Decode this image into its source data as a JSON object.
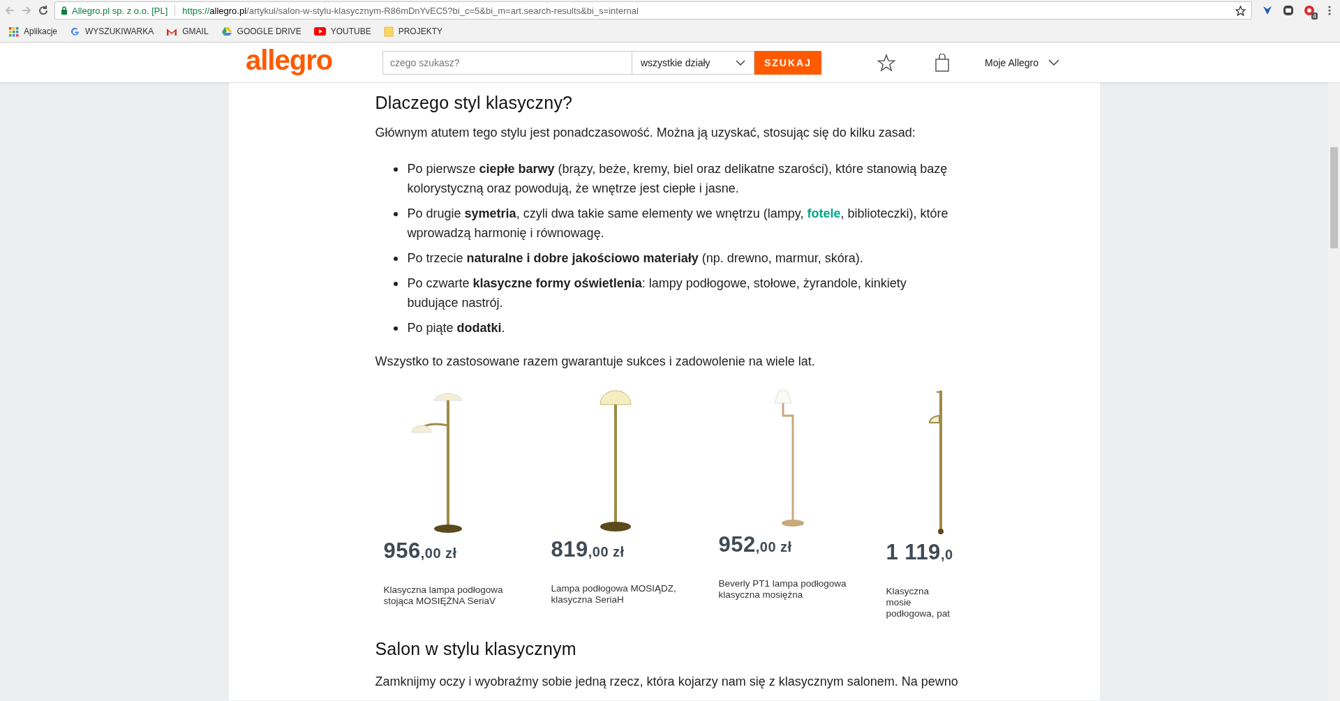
{
  "browser": {
    "site_identity": "Allegro.pl sp. z o.o. [PL]",
    "url": {
      "scheme": "https://",
      "host": "allegro.pl",
      "path": "/artykul/salon-w-stylu-klasycznym-R86mDnYvEC5?bi_c=5&bi_m=art.search-results&bi_s=internal"
    },
    "extension_badge": "4",
    "bookmarks": [
      {
        "kind": "apps",
        "label": "Aplikacje"
      },
      {
        "kind": "google",
        "label": "WYSZUKIWARKA"
      },
      {
        "kind": "gmail",
        "label": "GMAIL"
      },
      {
        "kind": "drive",
        "label": "GOOGLE DRIVE"
      },
      {
        "kind": "youtube",
        "label": "YOUTUBE"
      },
      {
        "kind": "folder",
        "label": "PROJEKTY"
      }
    ]
  },
  "header": {
    "logo": "allegro",
    "search_placeholder": "czego szukasz?",
    "category": "wszystkie działy",
    "search_button": "SZUKAJ",
    "account": "Moje Allegro"
  },
  "article": {
    "heading": "Dlaczego styl klasyczny?",
    "intro": "Głównym atutem tego stylu jest ponadczasowość. Można ją uzyskać, stosując się do kilku zasad:",
    "bullets": [
      [
        {
          "kind": "text",
          "text": "Po pierwsze **ciepłe barwy** (brązy, beże, kremy, biel oraz delikatne szarości), które stanowią bazę kolorystyczną oraz powodują, że wnętrze jest ciepłe i jasne."
        }
      ],
      [
        {
          "kind": "text",
          "text": "Po drugie **symetria**, czyli dwa takie same elementy we wnętrzu (lampy, "
        },
        {
          "kind": "link",
          "text": "fotele"
        },
        {
          "kind": "text",
          "text": ", biblioteczki), które wprowadzą harmonię i równowagę."
        }
      ],
      [
        {
          "kind": "text",
          "text": "Po trzecie **naturalne i dobre jakościowo materiały** (np. drewno, marmur, skóra)."
        }
      ],
      [
        {
          "kind": "text",
          "text": "Po czwarte **klasyczne formy oświetlenia**: lampy podłogowe, stołowe, żyrandole, kinkiety budujące nastrój."
        }
      ],
      [
        {
          "kind": "text",
          "text": "Po piąte **dodatki**."
        }
      ]
    ],
    "summary": "Wszystko to zastosowane razem gwarantuje sukces i zadowolenie na wiele lat.",
    "products": [
      {
        "kind": "double",
        "price_main": "956",
        "price_fraction": ",00 zł",
        "title": "Klasyczna lampa podłogowa stojąca MOSIĘŻNA SeriaV"
      },
      {
        "kind": "dome",
        "price_main": "819",
        "price_fraction": ",00 zł",
        "title": "Lampa podłogowa MOSIĄDZ, klasyczna SeriaH"
      },
      {
        "kind": "swing",
        "price_main": "952",
        "price_fraction": ",00 zł",
        "title": "Beverly PT1 lampa podłogowa klasyczna mosiężna"
      },
      {
        "kind": "partial",
        "price_main": "1 119",
        "price_fraction": ",0",
        "title": "Klasyczna mosie podłogowa, pat"
      }
    ],
    "heading2": "Salon w stylu klasycznym",
    "paragraph2": "Zamknijmy oczy i wyobraźmy sobie jedną rzecz, która kojarzy nam się z klasycznym salonem. Na pewno"
  }
}
